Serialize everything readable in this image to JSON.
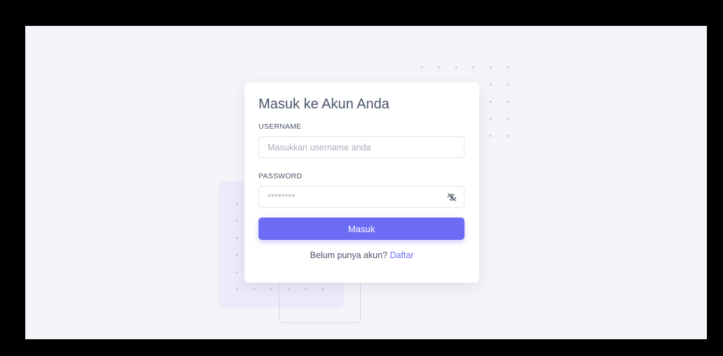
{
  "login": {
    "title": "Masuk ke Akun Anda",
    "username_label": "USERNAME",
    "username_placeholder": "Masukkan username anda",
    "password_label": "PASSWORD",
    "password_placeholder": "********",
    "submit_label": "Masuk",
    "register_prompt": "Belum punya akun?",
    "register_link": "Daftar"
  },
  "colors": {
    "accent": "#6c6cf5",
    "background": "#f4f4f9",
    "text": "#4a5568"
  }
}
